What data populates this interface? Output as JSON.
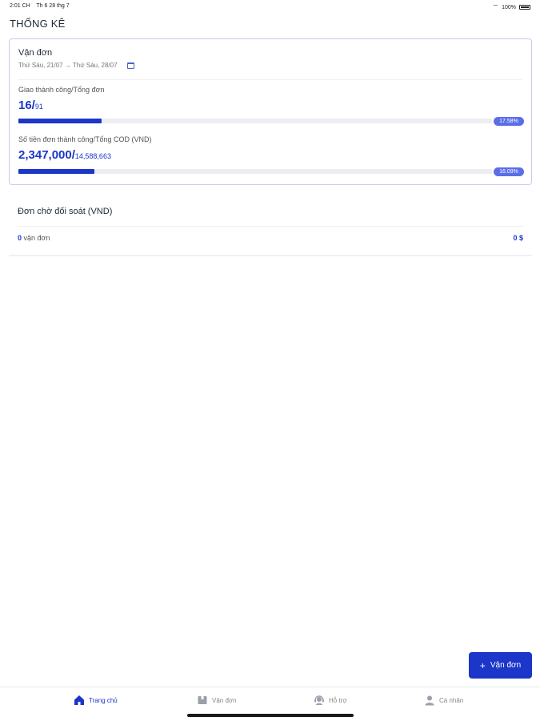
{
  "status_bar": {
    "time": "2:01 CH",
    "date": "Th 6 28 thg 7",
    "battery": "100%"
  },
  "page": {
    "title": "THỐNG KÊ"
  },
  "stats": {
    "title": "Vận đơn",
    "date_range": "Thứ Sáu, 21/07 → Thứ Sáu, 28/07",
    "delivery": {
      "label": "Giao thành công/Tổng đơn",
      "success": "16/",
      "total": "91",
      "percent_label": "17.58%",
      "percent": 17.58
    },
    "cod": {
      "label": "Số tiền đơn thành công/Tổng COD (VND)",
      "success": "2,347,000/",
      "total": "14,588,663",
      "percent_label": "16.09%",
      "percent": 16.09
    }
  },
  "reconciliation": {
    "title": "Đơn chờ đối soát (VND)",
    "count": "0",
    "count_unit": "vận đơn",
    "amount": "0 $"
  },
  "fab": {
    "label": "Vận đơn",
    "icon": "plus-icon"
  },
  "tabs": [
    {
      "label": "Trang chủ",
      "icon": "home-icon",
      "active": true
    },
    {
      "label": "Vận đơn",
      "icon": "package-icon",
      "active": false
    },
    {
      "label": "Hỗ trợ",
      "icon": "support-icon",
      "active": false
    },
    {
      "label": "Cá nhân",
      "icon": "user-icon",
      "active": false
    }
  ],
  "colors": {
    "primary": "#1b36c9",
    "badge": "#5b6ee8",
    "card_border": "#c7cbf2"
  }
}
